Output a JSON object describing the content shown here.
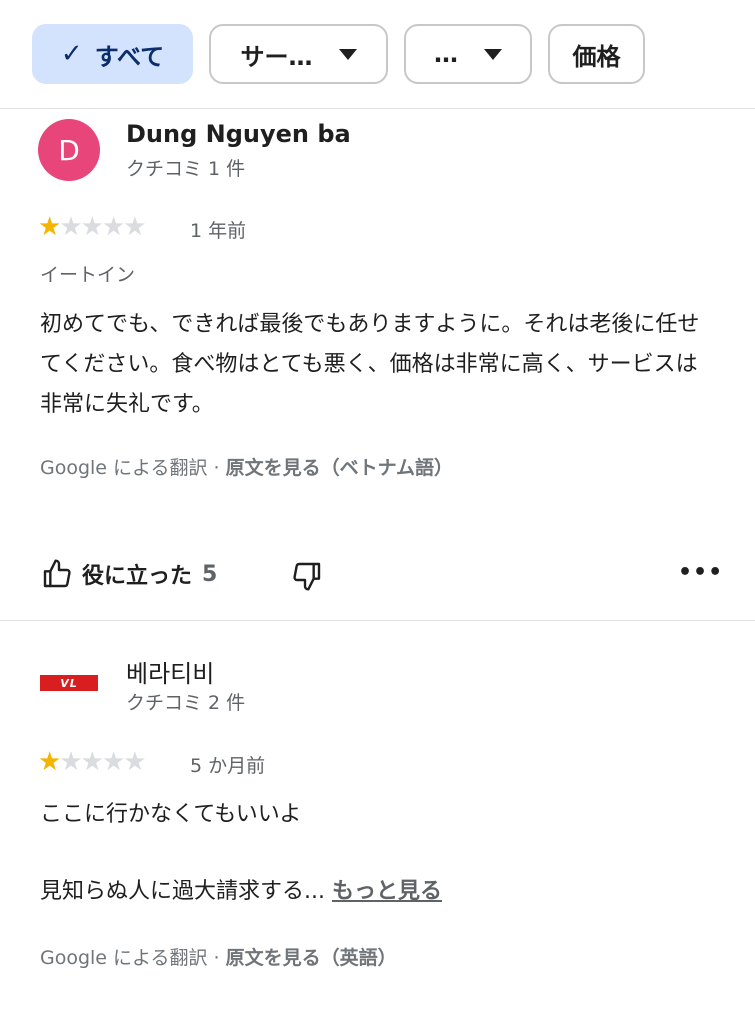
{
  "filters": {
    "all_label": "すべて",
    "service_label": "サー…",
    "more_label": "…",
    "price_label": "価格"
  },
  "reviews": [
    {
      "avatar_letter": "D",
      "avatar_color": "#e8457a",
      "name": "Dung Nguyen ba",
      "count": "クチコミ 1 件",
      "rating": 1,
      "date": "1 年前",
      "type": "イートイン",
      "text": "初めてでも、できれば最後でもありますように。それは老後に任せてください。食べ物はとても悪く、価格は非常に高く、サービスは非常に失礼です。",
      "translation_prefix": "Google による翻訳 · ",
      "translation_link": "原文を見る（ベトナム語）",
      "helpful_label": "役に立った",
      "helpful_count": "5"
    },
    {
      "avatar_logo_text": "VL",
      "name": "베라티비",
      "count": "クチコミ 2 件",
      "rating": 1,
      "date": "5 か月前",
      "text_line1": "ここに行かなくてもいいよ",
      "text_line2": "見知らぬ人に過大請求する... ",
      "more_label": "もっと見る",
      "translation_prefix": "Google による翻訳 · ",
      "translation_link": "原文を見る（英語）"
    }
  ],
  "colors": {
    "accent_chip": "#d3e3fd",
    "star": "#f4b400"
  }
}
